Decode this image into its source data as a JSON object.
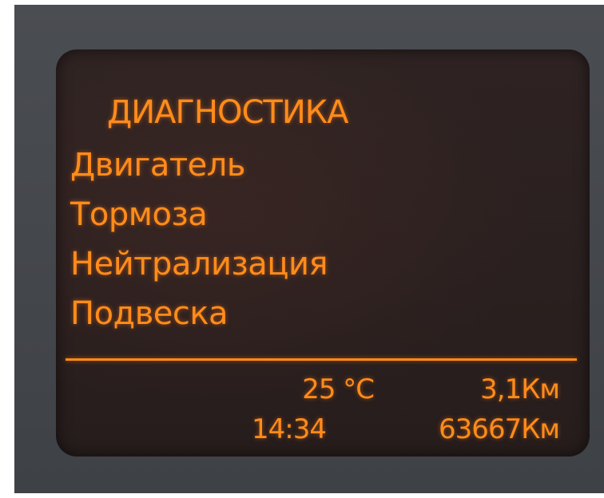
{
  "menu": {
    "title": "ДИАГНОСТИКА",
    "items": [
      {
        "label": "Двигатель"
      },
      {
        "label": "Тормоза"
      },
      {
        "label": "Нейтрализация"
      },
      {
        "label": "Подвеска"
      }
    ]
  },
  "status": {
    "temperature": "25 °C",
    "trip_distance": "3,1Км",
    "time": "14:34",
    "odometer": "63667Км"
  },
  "colors": {
    "display_text": "#ff8c1a",
    "screen_background": "#2a201f",
    "bezel": "#45484d"
  }
}
